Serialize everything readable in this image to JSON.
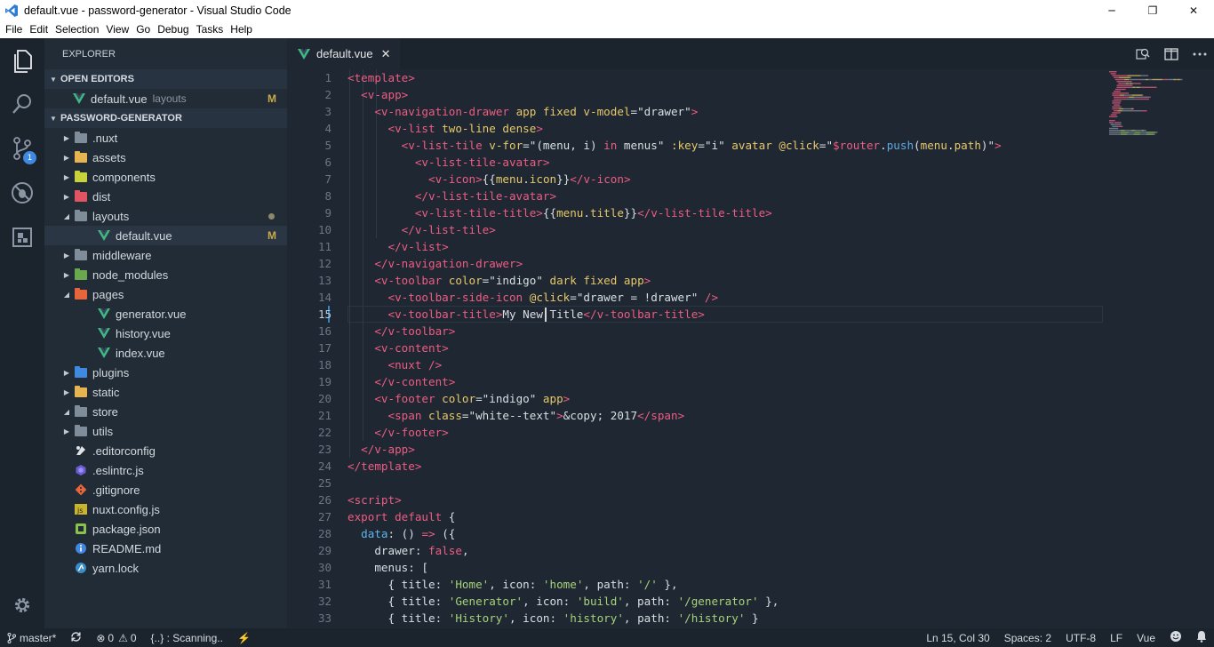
{
  "window": {
    "title": "default.vue - password-generator - Visual Studio Code",
    "minimize": "─",
    "maximize": "❐",
    "close": "✕"
  },
  "menu": [
    "File",
    "Edit",
    "Selection",
    "View",
    "Go",
    "Debug",
    "Tasks",
    "Help"
  ],
  "activity": {
    "scm_badge": "1"
  },
  "explorer": {
    "header": "EXPLORER",
    "open_editors_label": "OPEN EDITORS",
    "open_editor": {
      "name": "default.vue",
      "folder": "layouts",
      "status": "M"
    },
    "project_label": "PASSWORD-GENERATOR",
    "items": [
      {
        "name": ".nuxt",
        "icon": "folder-icon",
        "color": "#7f8c99"
      },
      {
        "name": "assets",
        "icon": "folder-icon",
        "color": "#e6b450"
      },
      {
        "name": "components",
        "icon": "folder-icon",
        "color": "#c8d23a"
      },
      {
        "name": "dist",
        "icon": "folder-icon",
        "color": "#e05561"
      },
      {
        "name": "layouts",
        "icon": "folder-icon",
        "color": "#7f8c99",
        "open": true
      },
      {
        "name": "default.vue",
        "icon": "vue-icon",
        "child": true,
        "active": true,
        "status": "M"
      },
      {
        "name": "middleware",
        "icon": "folder-icon",
        "color": "#7f8c99"
      },
      {
        "name": "node_modules",
        "icon": "folder-icon",
        "color": "#6aa84f"
      },
      {
        "name": "pages",
        "icon": "folder-icon",
        "color": "#e8643a",
        "open": true
      },
      {
        "name": "generator.vue",
        "icon": "vue-icon",
        "child": true
      },
      {
        "name": "history.vue",
        "icon": "vue-icon",
        "child": true
      },
      {
        "name": "index.vue",
        "icon": "vue-icon",
        "child": true
      },
      {
        "name": "plugins",
        "icon": "folder-icon",
        "color": "#3f89e0"
      },
      {
        "name": "static",
        "icon": "folder-icon",
        "color": "#e6b450"
      },
      {
        "name": "store",
        "icon": "folder-icon",
        "color": "#7f8c99",
        "open": true
      },
      {
        "name": "utils",
        "icon": "folder-icon",
        "color": "#7f8c99"
      },
      {
        "name": ".editorconfig",
        "icon": "editorconfig-icon"
      },
      {
        "name": ".eslintrc.js",
        "icon": "eslint-icon"
      },
      {
        "name": ".gitignore",
        "icon": "git-icon"
      },
      {
        "name": "nuxt.config.js",
        "icon": "js-icon"
      },
      {
        "name": "package.json",
        "icon": "npm-icon"
      },
      {
        "name": "README.md",
        "icon": "info-icon"
      },
      {
        "name": "yarn.lock",
        "icon": "yarn-icon"
      }
    ]
  },
  "tab": {
    "label": "default.vue",
    "close": "✕"
  },
  "editor": {
    "current_line": 15,
    "lines": [
      [
        [
          "t",
          "<template>"
        ]
      ],
      [
        [
          "s",
          "  "
        ],
        [
          "t",
          "<v-app>"
        ]
      ],
      [
        [
          "s",
          "    "
        ],
        [
          "t",
          "<v-navigation-drawer"
        ],
        [
          "a",
          " app fixed v-model"
        ],
        [
          "s",
          "=\"drawer\""
        ],
        [
          "t",
          ">"
        ]
      ],
      [
        [
          "s",
          "      "
        ],
        [
          "t",
          "<v-list"
        ],
        [
          "a",
          " two-line dense"
        ],
        [
          "t",
          ">"
        ]
      ],
      [
        [
          "s",
          "        "
        ],
        [
          "t",
          "<v-list-tile"
        ],
        [
          "a",
          " v-for"
        ],
        [
          "s",
          "=\"(menu, i) "
        ],
        [
          "k",
          "in"
        ],
        [
          "s",
          " menus\" "
        ],
        [
          "a",
          ":key"
        ],
        [
          "s",
          "=\"i\" "
        ],
        [
          "a",
          "avatar @click"
        ],
        [
          "s",
          "=\""
        ],
        [
          "d",
          "$router"
        ],
        [
          "s",
          "."
        ],
        [
          "fn",
          "push"
        ],
        [
          "s",
          "("
        ],
        [
          "u",
          "menu"
        ],
        [
          "s",
          "."
        ],
        [
          "u",
          "path"
        ],
        [
          "s",
          ")\""
        ],
        [
          "t",
          ">"
        ]
      ],
      [
        [
          "s",
          "          "
        ],
        [
          "t",
          "<v-list-tile-avatar>"
        ]
      ],
      [
        [
          "s",
          "            "
        ],
        [
          "t",
          "<v-icon>"
        ],
        [
          "s",
          "{{"
        ],
        [
          "u",
          "menu"
        ],
        [
          "s",
          "."
        ],
        [
          "u",
          "icon"
        ],
        [
          "s",
          "}}"
        ],
        [
          "t",
          "</v-icon>"
        ]
      ],
      [
        [
          "s",
          "          "
        ],
        [
          "t",
          "</v-list-tile-avatar>"
        ]
      ],
      [
        [
          "s",
          "          "
        ],
        [
          "t",
          "<v-list-tile-title>"
        ],
        [
          "s",
          "{{"
        ],
        [
          "u",
          "menu"
        ],
        [
          "s",
          "."
        ],
        [
          "u",
          "title"
        ],
        [
          "s",
          "}}"
        ],
        [
          "t",
          "</v-list-tile-title>"
        ]
      ],
      [
        [
          "s",
          "        "
        ],
        [
          "t",
          "</v-list-tile>"
        ]
      ],
      [
        [
          "s",
          "      "
        ],
        [
          "t",
          "</v-list>"
        ]
      ],
      [
        [
          "s",
          "    "
        ],
        [
          "t",
          "</v-navigation-drawer>"
        ]
      ],
      [
        [
          "s",
          "    "
        ],
        [
          "t",
          "<v-toolbar"
        ],
        [
          "a",
          " color"
        ],
        [
          "s",
          "=\"indigo\" "
        ],
        [
          "a",
          "dark fixed app"
        ],
        [
          "t",
          ">"
        ]
      ],
      [
        [
          "s",
          "      "
        ],
        [
          "t",
          "<v-toolbar-side-icon"
        ],
        [
          "a",
          " @click"
        ],
        [
          "s",
          "=\"drawer = !drawer\" "
        ],
        [
          "t",
          "/>"
        ]
      ],
      [
        [
          "s",
          "      "
        ],
        [
          "t",
          "<v-toolbar-title>"
        ],
        [
          "s",
          "My New Title"
        ],
        [
          "t",
          "</v-toolbar-title>"
        ]
      ],
      [
        [
          "s",
          "    "
        ],
        [
          "t",
          "</v-toolbar>"
        ]
      ],
      [
        [
          "s",
          "    "
        ],
        [
          "t",
          "<v-content>"
        ]
      ],
      [
        [
          "s",
          "      "
        ],
        [
          "t",
          "<nuxt />"
        ]
      ],
      [
        [
          "s",
          "    "
        ],
        [
          "t",
          "</v-content>"
        ]
      ],
      [
        [
          "s",
          "    "
        ],
        [
          "t",
          "<v-footer"
        ],
        [
          "a",
          " color"
        ],
        [
          "s",
          "=\"indigo\" "
        ],
        [
          "a",
          "app"
        ],
        [
          "t",
          ">"
        ]
      ],
      [
        [
          "s",
          "      "
        ],
        [
          "t",
          "<span"
        ],
        [
          "a",
          " class"
        ],
        [
          "s",
          "=\"white--text\""
        ],
        [
          "t",
          ">"
        ],
        [
          "s",
          "&copy; 2017"
        ],
        [
          "t",
          "</span>"
        ]
      ],
      [
        [
          "s",
          "    "
        ],
        [
          "t",
          "</v-footer>"
        ]
      ],
      [
        [
          "s",
          "  "
        ],
        [
          "t",
          "</v-app>"
        ]
      ],
      [
        [
          "t",
          "</template>"
        ]
      ],
      [
        [
          "s",
          ""
        ]
      ],
      [
        [
          "t",
          "<script>"
        ]
      ],
      [
        [
          "k",
          "export"
        ],
        [
          "s",
          " "
        ],
        [
          "k",
          "default"
        ],
        [
          "s",
          " {"
        ]
      ],
      [
        [
          "s",
          "  "
        ],
        [
          "p",
          "data"
        ],
        [
          "s",
          ": () "
        ],
        [
          "k",
          "=>"
        ],
        [
          "s",
          " ({"
        ]
      ],
      [
        [
          "s",
          "    "
        ],
        [
          "s",
          "drawer: "
        ],
        [
          "k",
          "false"
        ],
        [
          "s",
          ","
        ]
      ],
      [
        [
          "s",
          "    menus: ["
        ]
      ],
      [
        [
          "s",
          "      { title: "
        ],
        [
          "str2",
          "'Home'"
        ],
        [
          "s",
          ", icon: "
        ],
        [
          "str2",
          "'home'"
        ],
        [
          "s",
          ", path: "
        ],
        [
          "str2",
          "'/'"
        ],
        [
          "s",
          " },"
        ]
      ],
      [
        [
          "s",
          "      { title: "
        ],
        [
          "str2",
          "'Generator'"
        ],
        [
          "s",
          ", icon: "
        ],
        [
          "str2",
          "'build'"
        ],
        [
          "s",
          ", path: "
        ],
        [
          "str2",
          "'/generator'"
        ],
        [
          "s",
          " },"
        ]
      ],
      [
        [
          "s",
          "      { title: "
        ],
        [
          "str2",
          "'History'"
        ],
        [
          "s",
          ", icon: "
        ],
        [
          "str2",
          "'history'"
        ],
        [
          "s",
          ", path: "
        ],
        [
          "str2",
          "'/history'"
        ],
        [
          "s",
          " }"
        ]
      ]
    ]
  },
  "status": {
    "branch": "master*",
    "errors": "0",
    "warnings": "0",
    "scanning": "{..} : Scanning..",
    "position": "Ln 15, Col 30",
    "spaces": "Spaces: 2",
    "encoding": "UTF-8",
    "eol": "LF",
    "language": "Vue"
  }
}
